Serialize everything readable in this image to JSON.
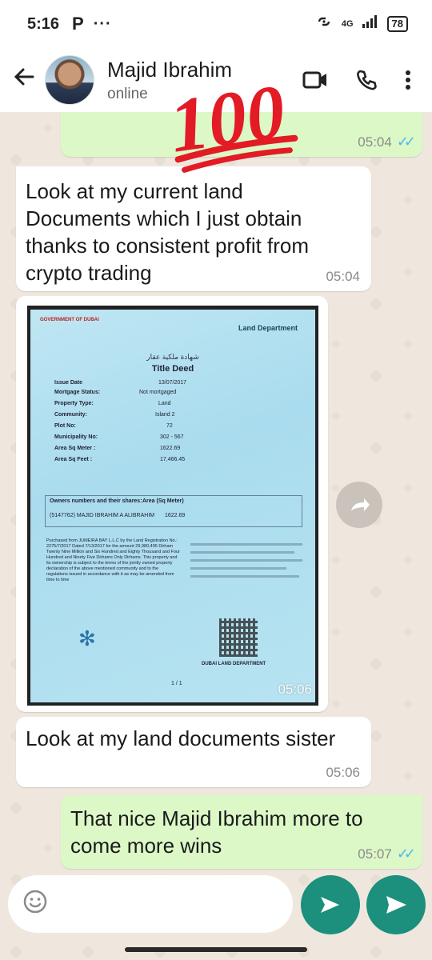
{
  "status_bar": {
    "time": "5:16",
    "carrier_icon": "P",
    "more": "···",
    "network": "4G",
    "battery": "78"
  },
  "header": {
    "name": "Majid Ibrahim",
    "status": "online"
  },
  "messages": [
    {
      "direction": "out",
      "text": "",
      "time": "05:04"
    },
    {
      "direction": "in",
      "text": "Look at my current land Documents which I just obtain thanks to consistent profit from crypto trading",
      "time": "05:04"
    },
    {
      "direction": "in",
      "type": "image",
      "time": "05:06"
    },
    {
      "direction": "in",
      "text": "Look at my land documents sister",
      "time": "05:06"
    },
    {
      "direction": "out",
      "text": "That nice Majid Ibrahim more to come more wins",
      "time": "05:07"
    }
  ],
  "sticker": {
    "text": "100"
  },
  "document": {
    "gov": "GOVERNMENT OF DUBAI",
    "dept": "Land Department",
    "arabic_title": "شهادة ملكية عقار",
    "title": "Title Deed",
    "fields": [
      {
        "label": "Issue Date",
        "value": "13/07/2017"
      },
      {
        "label": "Mortgage Status:",
        "value": "Not mortgaged"
      },
      {
        "label": "Property Type:",
        "value": "Land"
      },
      {
        "label": "Community:",
        "value": "Island 2"
      },
      {
        "label": "Plot No:",
        "value": "72"
      },
      {
        "label": "Municipality No:",
        "value": "302 - 567"
      },
      {
        "label": "Area Sq Meter :",
        "value": "1622.69"
      },
      {
        "label": "Area Sq Feet :",
        "value": "17,466.45"
      }
    ],
    "owners_header": "Owners numbers and their shares:",
    "area_header": "Area (Sq Meter)",
    "owner": "(5147762) MAJID IBRAHIM A ALIBRAHIM",
    "owner_area": "1622.69",
    "paragraph": "Purchased from JUMEIRA BAY L.L.C by the Land Registration No.: 2275/7/2017 Dated 7/13/2017 for the amount 29,980,495 Dirham Twenty Nine Million and Six Hundred and Eighty Thousand and Four Hundred and Ninety Five Dirhams Only Dirhams. This property and its ownership is subject to the terms of the jointly owned property declaration of the above mentioned community and to the regulations issued in accordance with it as may be amended from time to time",
    "footer_dept": "DUBAI LAND DEPARTMENT",
    "page": "1 / 1"
  },
  "input": {
    "placeholder": ""
  }
}
